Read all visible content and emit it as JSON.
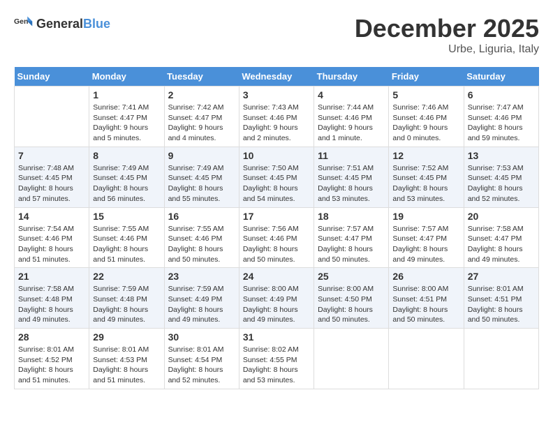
{
  "logo": {
    "general": "General",
    "blue": "Blue"
  },
  "header": {
    "month": "December 2025",
    "location": "Urbe, Liguria, Italy"
  },
  "weekdays": [
    "Sunday",
    "Monday",
    "Tuesday",
    "Wednesday",
    "Thursday",
    "Friday",
    "Saturday"
  ],
  "weeks": [
    [
      {
        "day": "",
        "sunrise": "",
        "sunset": "",
        "daylight": ""
      },
      {
        "day": "1",
        "sunrise": "Sunrise: 7:41 AM",
        "sunset": "Sunset: 4:47 PM",
        "daylight": "Daylight: 9 hours and 5 minutes."
      },
      {
        "day": "2",
        "sunrise": "Sunrise: 7:42 AM",
        "sunset": "Sunset: 4:47 PM",
        "daylight": "Daylight: 9 hours and 4 minutes."
      },
      {
        "day": "3",
        "sunrise": "Sunrise: 7:43 AM",
        "sunset": "Sunset: 4:46 PM",
        "daylight": "Daylight: 9 hours and 2 minutes."
      },
      {
        "day": "4",
        "sunrise": "Sunrise: 7:44 AM",
        "sunset": "Sunset: 4:46 PM",
        "daylight": "Daylight: 9 hours and 1 minute."
      },
      {
        "day": "5",
        "sunrise": "Sunrise: 7:46 AM",
        "sunset": "Sunset: 4:46 PM",
        "daylight": "Daylight: 9 hours and 0 minutes."
      },
      {
        "day": "6",
        "sunrise": "Sunrise: 7:47 AM",
        "sunset": "Sunset: 4:46 PM",
        "daylight": "Daylight: 8 hours and 59 minutes."
      }
    ],
    [
      {
        "day": "7",
        "sunrise": "Sunrise: 7:48 AM",
        "sunset": "Sunset: 4:45 PM",
        "daylight": "Daylight: 8 hours and 57 minutes."
      },
      {
        "day": "8",
        "sunrise": "Sunrise: 7:49 AM",
        "sunset": "Sunset: 4:45 PM",
        "daylight": "Daylight: 8 hours and 56 minutes."
      },
      {
        "day": "9",
        "sunrise": "Sunrise: 7:49 AM",
        "sunset": "Sunset: 4:45 PM",
        "daylight": "Daylight: 8 hours and 55 minutes."
      },
      {
        "day": "10",
        "sunrise": "Sunrise: 7:50 AM",
        "sunset": "Sunset: 4:45 PM",
        "daylight": "Daylight: 8 hours and 54 minutes."
      },
      {
        "day": "11",
        "sunrise": "Sunrise: 7:51 AM",
        "sunset": "Sunset: 4:45 PM",
        "daylight": "Daylight: 8 hours and 53 minutes."
      },
      {
        "day": "12",
        "sunrise": "Sunrise: 7:52 AM",
        "sunset": "Sunset: 4:45 PM",
        "daylight": "Daylight: 8 hours and 53 minutes."
      },
      {
        "day": "13",
        "sunrise": "Sunrise: 7:53 AM",
        "sunset": "Sunset: 4:45 PM",
        "daylight": "Daylight: 8 hours and 52 minutes."
      }
    ],
    [
      {
        "day": "14",
        "sunrise": "Sunrise: 7:54 AM",
        "sunset": "Sunset: 4:46 PM",
        "daylight": "Daylight: 8 hours and 51 minutes."
      },
      {
        "day": "15",
        "sunrise": "Sunrise: 7:55 AM",
        "sunset": "Sunset: 4:46 PM",
        "daylight": "Daylight: 8 hours and 51 minutes."
      },
      {
        "day": "16",
        "sunrise": "Sunrise: 7:55 AM",
        "sunset": "Sunset: 4:46 PM",
        "daylight": "Daylight: 8 hours and 50 minutes."
      },
      {
        "day": "17",
        "sunrise": "Sunrise: 7:56 AM",
        "sunset": "Sunset: 4:46 PM",
        "daylight": "Daylight: 8 hours and 50 minutes."
      },
      {
        "day": "18",
        "sunrise": "Sunrise: 7:57 AM",
        "sunset": "Sunset: 4:47 PM",
        "daylight": "Daylight: 8 hours and 50 minutes."
      },
      {
        "day": "19",
        "sunrise": "Sunrise: 7:57 AM",
        "sunset": "Sunset: 4:47 PM",
        "daylight": "Daylight: 8 hours and 49 minutes."
      },
      {
        "day": "20",
        "sunrise": "Sunrise: 7:58 AM",
        "sunset": "Sunset: 4:47 PM",
        "daylight": "Daylight: 8 hours and 49 minutes."
      }
    ],
    [
      {
        "day": "21",
        "sunrise": "Sunrise: 7:58 AM",
        "sunset": "Sunset: 4:48 PM",
        "daylight": "Daylight: 8 hours and 49 minutes."
      },
      {
        "day": "22",
        "sunrise": "Sunrise: 7:59 AM",
        "sunset": "Sunset: 4:48 PM",
        "daylight": "Daylight: 8 hours and 49 minutes."
      },
      {
        "day": "23",
        "sunrise": "Sunrise: 7:59 AM",
        "sunset": "Sunset: 4:49 PM",
        "daylight": "Daylight: 8 hours and 49 minutes."
      },
      {
        "day": "24",
        "sunrise": "Sunrise: 8:00 AM",
        "sunset": "Sunset: 4:49 PM",
        "daylight": "Daylight: 8 hours and 49 minutes."
      },
      {
        "day": "25",
        "sunrise": "Sunrise: 8:00 AM",
        "sunset": "Sunset: 4:50 PM",
        "daylight": "Daylight: 8 hours and 50 minutes."
      },
      {
        "day": "26",
        "sunrise": "Sunrise: 8:00 AM",
        "sunset": "Sunset: 4:51 PM",
        "daylight": "Daylight: 8 hours and 50 minutes."
      },
      {
        "day": "27",
        "sunrise": "Sunrise: 8:01 AM",
        "sunset": "Sunset: 4:51 PM",
        "daylight": "Daylight: 8 hours and 50 minutes."
      }
    ],
    [
      {
        "day": "28",
        "sunrise": "Sunrise: 8:01 AM",
        "sunset": "Sunset: 4:52 PM",
        "daylight": "Daylight: 8 hours and 51 minutes."
      },
      {
        "day": "29",
        "sunrise": "Sunrise: 8:01 AM",
        "sunset": "Sunset: 4:53 PM",
        "daylight": "Daylight: 8 hours and 51 minutes."
      },
      {
        "day": "30",
        "sunrise": "Sunrise: 8:01 AM",
        "sunset": "Sunset: 4:54 PM",
        "daylight": "Daylight: 8 hours and 52 minutes."
      },
      {
        "day": "31",
        "sunrise": "Sunrise: 8:02 AM",
        "sunset": "Sunset: 4:55 PM",
        "daylight": "Daylight: 8 hours and 53 minutes."
      },
      {
        "day": "",
        "sunrise": "",
        "sunset": "",
        "daylight": ""
      },
      {
        "day": "",
        "sunrise": "",
        "sunset": "",
        "daylight": ""
      },
      {
        "day": "",
        "sunrise": "",
        "sunset": "",
        "daylight": ""
      }
    ]
  ]
}
